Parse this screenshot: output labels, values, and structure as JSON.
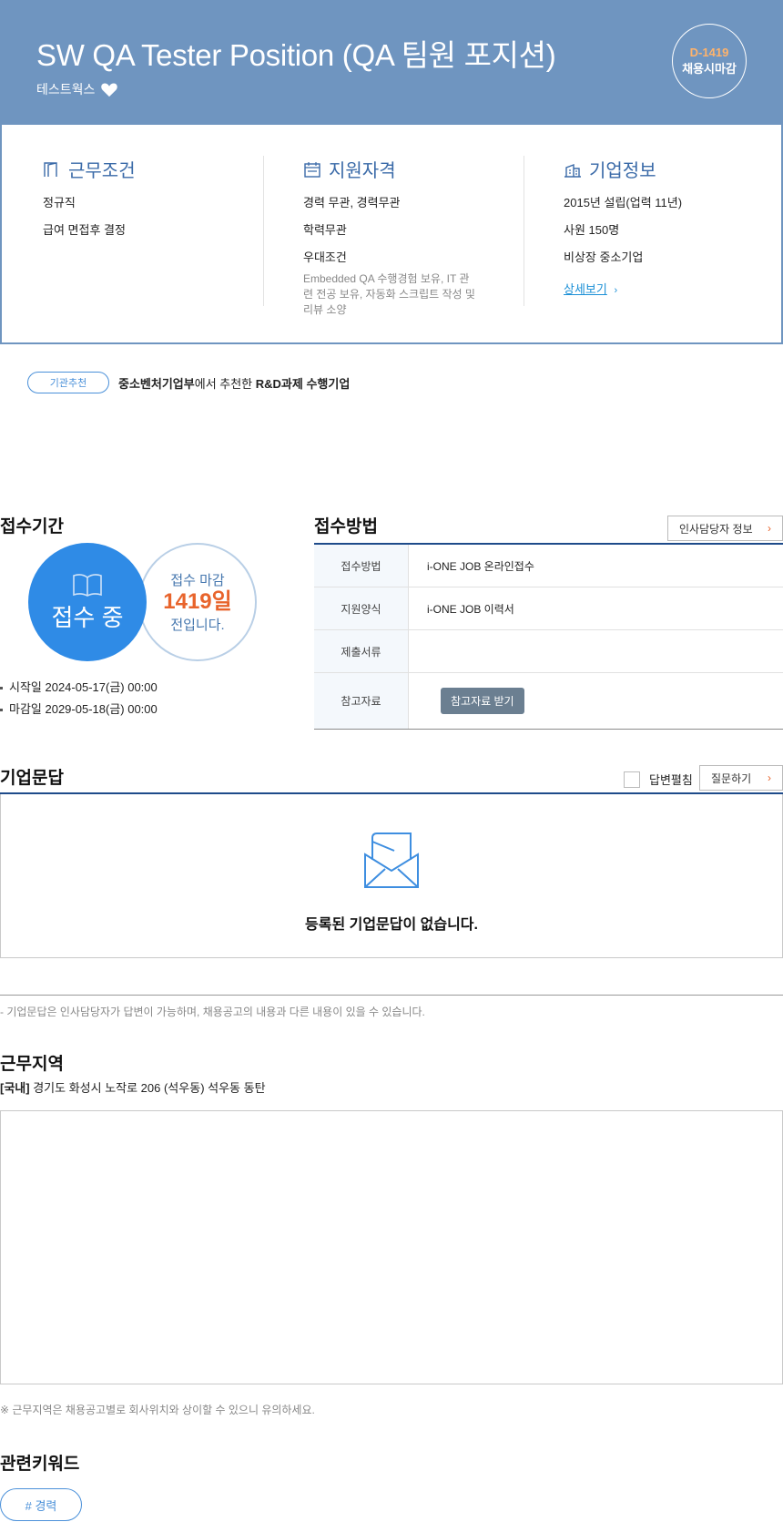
{
  "header": {
    "title": "SW QA Tester Position (QA 팀원 포지션)",
    "company": "테스트웍스",
    "dday": "D-1419",
    "dday_label": "채용시마감"
  },
  "conditions": {
    "title": "근무조건",
    "items": [
      "정규직",
      "급여 면접후 결정"
    ]
  },
  "qualifications": {
    "title": "지원자격",
    "items": [
      "경력 무관, 경력무관",
      "학력무관",
      "우대조건"
    ],
    "preferred": "Embedded QA 수행경험 보유, IT 관련 전공 보유, 자동화 스크립트 작성 및 리뷰 소양"
  },
  "company_info": {
    "title": "기업정보",
    "items": [
      "2015년 설립(업력 11년)",
      "사원 150명",
      "비상장 중소기업"
    ],
    "detail_link": "상세보기"
  },
  "badge": {
    "pill": "기관추천",
    "agency": "중소벤처기업부",
    "middle": "에서 추천한 ",
    "project": "R&D과제 수행기업"
  },
  "period": {
    "title": "접수기간",
    "status": "접수 중",
    "deadline_label": "접수 마감",
    "days": "1419일",
    "suffix": "전입니다.",
    "start": "시작일 2024-05-17(금) 00:00",
    "end": "마감일 2029-05-18(금) 00:00"
  },
  "method": {
    "title": "접수방법",
    "hr_button": "인사담당자 정보",
    "rows": [
      {
        "label": "접수방법",
        "value": "i-ONE JOB 온라인접수"
      },
      {
        "label": "지원양식",
        "value": "i-ONE JOB 이력서"
      },
      {
        "label": "제출서류",
        "value": ""
      },
      {
        "label": "참고자료",
        "value": ""
      }
    ],
    "ref_button": "참고자료 받기"
  },
  "qa": {
    "title": "기업문답",
    "expand_label": "답변펼침",
    "ask_button": "질문하기",
    "empty": "등록된 기업문답이 없습니다.",
    "note": "- 기업문답은 인사담당자가 답변이 가능하며, 채용공고의 내용과 다른 내용이 있을 수 있습니다."
  },
  "location": {
    "title": "근무지역",
    "region": "[국내]",
    "address": " 경기도 화성시 노작로 206 (석우동) 석우동 동탄",
    "note": "※ 근무지역은 채용공고별로 회사위치와 상이할 수 있으니 유의하세요."
  },
  "keywords": {
    "title": "관련키워드",
    "items": [
      "# 경력"
    ]
  },
  "colors": {
    "header_bg": "#6f95c0",
    "accent_blue": "#2f8be6",
    "navy": "#1e4b8a",
    "orange": "#e8642c"
  }
}
